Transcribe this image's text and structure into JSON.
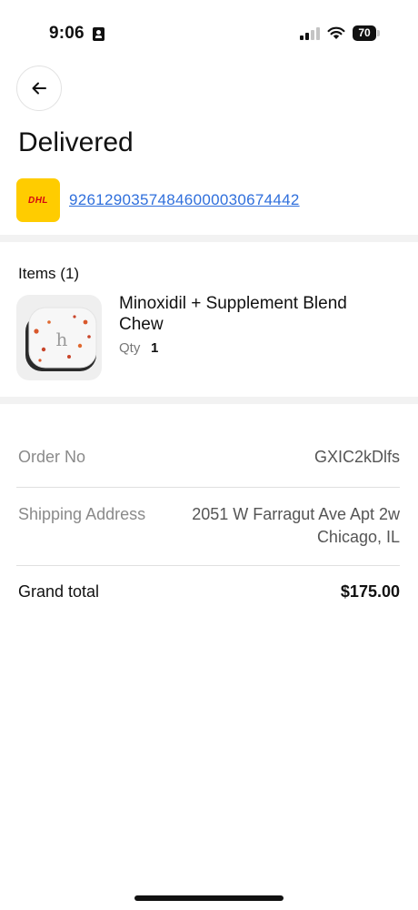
{
  "status_bar": {
    "time": "9:06",
    "battery": "70",
    "icons": [
      "contact-card-icon",
      "signal-icon",
      "wifi-icon",
      "battery-icon"
    ]
  },
  "header": {
    "back_icon": "arrow-left-icon",
    "title": "Delivered"
  },
  "shipment": {
    "carrier": "DHL",
    "carrier_color": "#FFCC00",
    "carrier_text_color": "#D40511",
    "tracking_number": "92612903574846000030674442",
    "link_color": "#2f6fdc"
  },
  "items": {
    "header": "Items (1)",
    "list": [
      {
        "name": "Minoxidil + Supplement Blend Chew",
        "qty_label": "Qty",
        "qty": "1",
        "thumb_letter": "h"
      }
    ]
  },
  "summary": {
    "order_no_label": "Order No",
    "order_no_value": "GXIC2kDlfs",
    "shipping_label": "Shipping Address",
    "address_line1": "2051 W Farragut Ave Apt 2w",
    "address_line2": "Chicago, IL",
    "total_label": "Grand total",
    "total_value": "$175.00"
  }
}
